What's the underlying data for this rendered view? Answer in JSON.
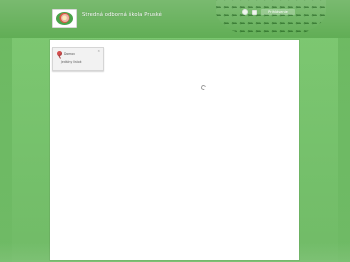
{
  "header": {
    "title": "Stredná odborná škola Pruské",
    "chip_label": "Prihlásenie"
  },
  "menu": {
    "head_label": "Domov",
    "item_label": "Jedálny lístok"
  },
  "icons": {
    "logo": "school-logo",
    "tool_1": "home-icon",
    "tool_2": "flag-icon",
    "menu_pin": "pin-icon",
    "menu_close": "close-icon",
    "loading": "loading-icon"
  },
  "colors": {
    "background": "#6fbd63",
    "panel": "#ffffff",
    "accent": "#d54e4e"
  }
}
